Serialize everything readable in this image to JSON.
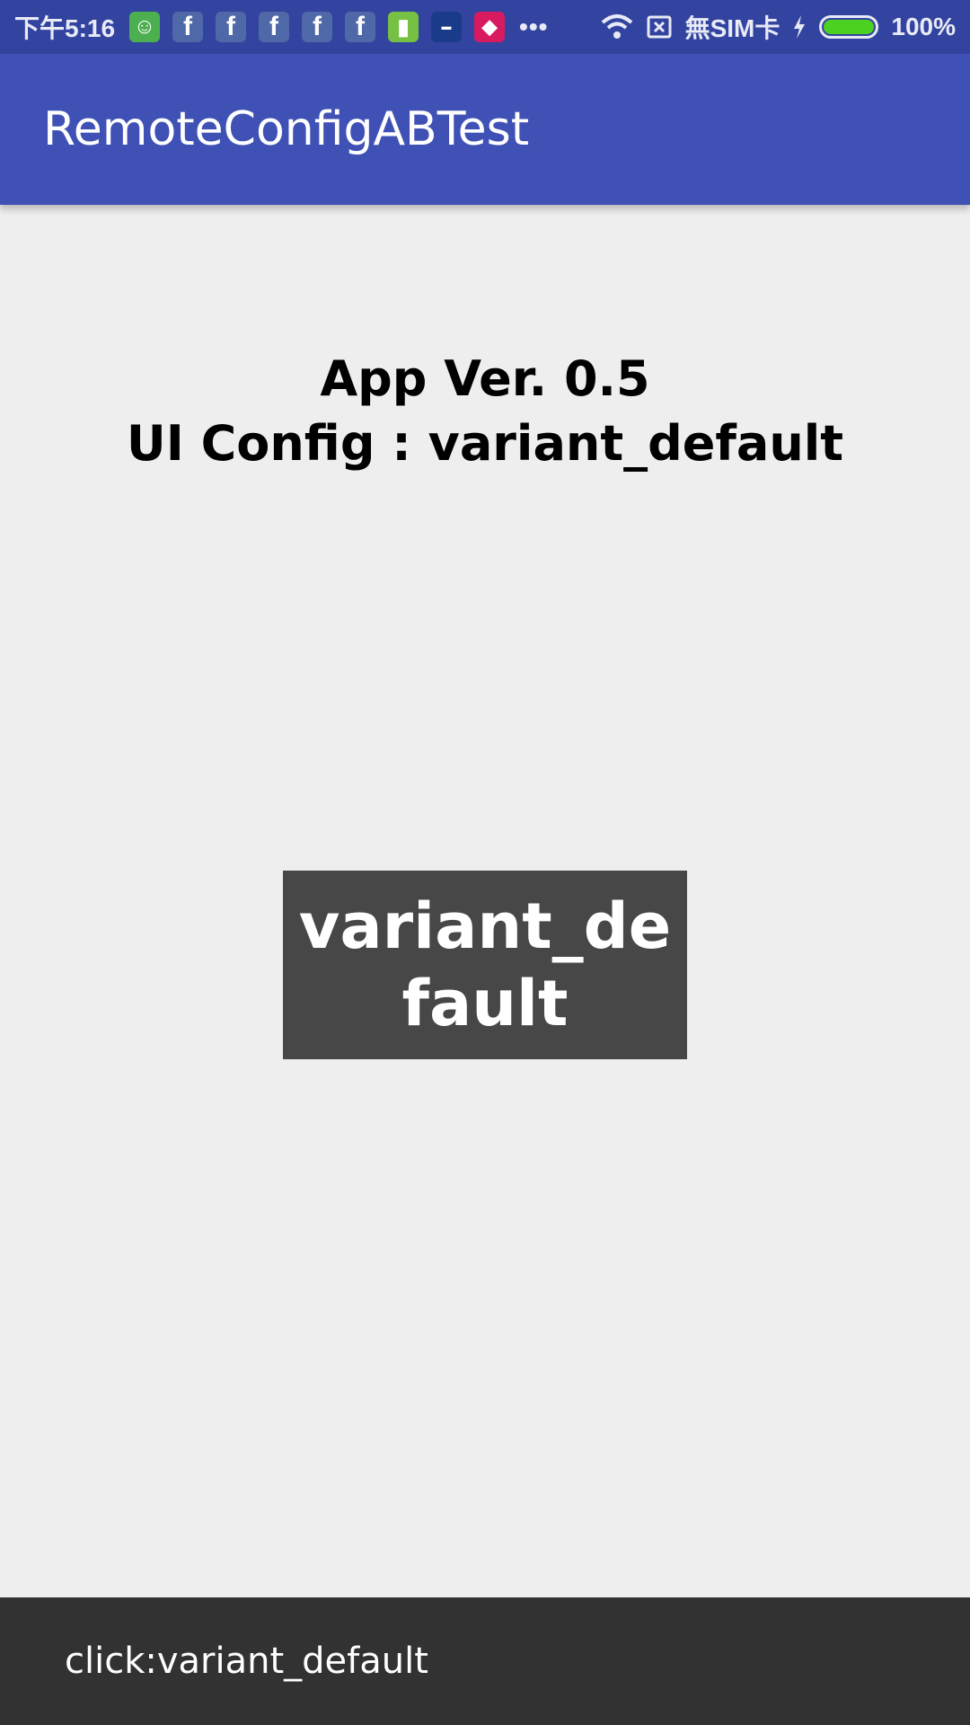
{
  "status_bar": {
    "time": "下午5:16",
    "icons": [
      "green-android-app-icon",
      "facebook-icon",
      "facebook-icon",
      "facebook-icon",
      "facebook-icon",
      "facebook-icon",
      "green-battery-app-icon",
      "setn-news-icon",
      "entertainment-app-icon"
    ],
    "overflow": "•••",
    "sim_status": "無SIM卡",
    "battery_percent": "100%",
    "battery_level": 1.0
  },
  "app_bar": {
    "title": "RemoteConfigABTest"
  },
  "main": {
    "version_line": "App Ver. 0.5",
    "config_line": "UI Config : variant_default",
    "variant_button_label": "variant_default"
  },
  "snackbar": {
    "message": "click:variant_default"
  },
  "colors": {
    "status_bar": "#3344a0",
    "app_bar": "#3f51b5",
    "background": "#eeeeee",
    "variant_button": "#474747",
    "snackbar": "#323232",
    "battery_fill": "#4cd120"
  }
}
